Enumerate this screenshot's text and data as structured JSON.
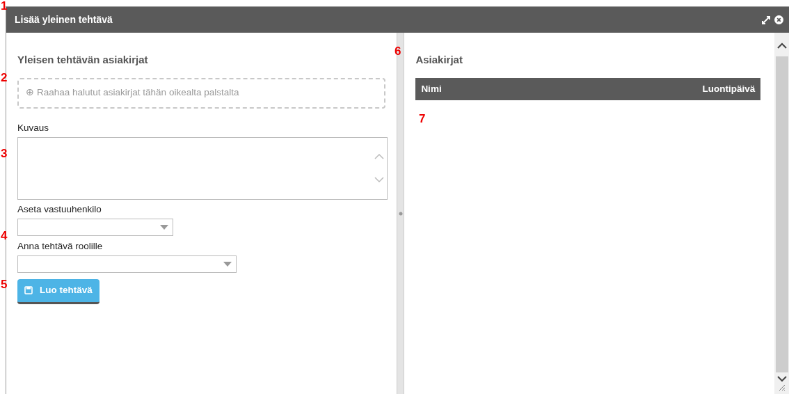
{
  "window": {
    "title": "Lisää yleinen tehtävä"
  },
  "left": {
    "heading": "Yleisen tehtävän asiakirjat",
    "dropzone": {
      "icon": "⊕",
      "text": "Raahaa halutut asiakirjat tähän oikealta palstalta"
    },
    "fields": [
      {
        "kind": "textarea",
        "label": "Kuvaus"
      },
      {
        "kind": "picker",
        "label": "Aseta vastuuhenkilo"
      },
      {
        "kind": "select",
        "label": "Anna tehtävä roolille"
      }
    ],
    "button": {
      "label": "Luo tehtävä"
    }
  },
  "right": {
    "heading": "Asiakirjat",
    "table": {
      "columns": [
        "Nimi",
        "Luontipäivä"
      ]
    }
  },
  "callouts": [
    "1",
    "2",
    "3",
    "4",
    "5",
    "6",
    "7"
  ]
}
